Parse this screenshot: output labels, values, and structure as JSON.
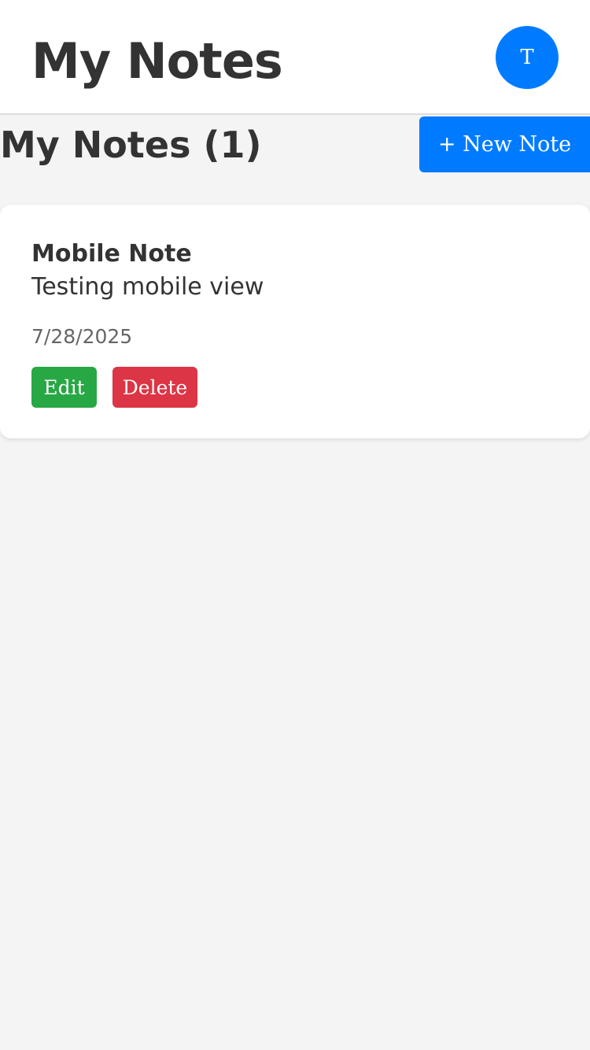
{
  "header": {
    "title": "My Notes",
    "avatar_initial": "T"
  },
  "toolbar": {
    "heading": "My Notes (1)",
    "new_note_label": "+ New Note"
  },
  "notes": [
    {
      "title": "Mobile Note",
      "body": "Testing mobile view",
      "date": "7/28/2025",
      "edit_label": "Edit",
      "delete_label": "Delete"
    }
  ],
  "colors": {
    "primary": "#007bff",
    "success": "#28a745",
    "danger": "#dc3545",
    "background": "#f4f4f4",
    "text": "#333333"
  }
}
